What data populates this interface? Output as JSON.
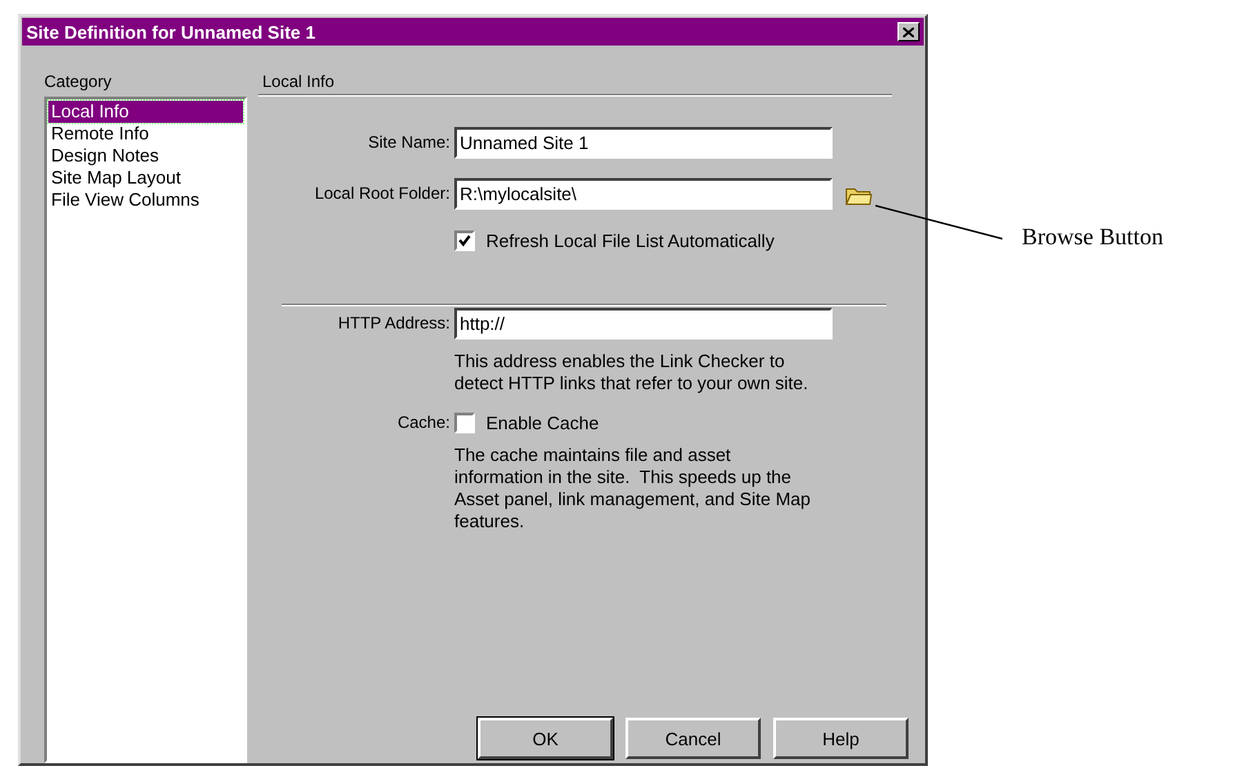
{
  "window": {
    "title": "Site Definition for Unnamed Site 1"
  },
  "category": {
    "label": "Category",
    "items": [
      {
        "label": "Local Info",
        "selected": true
      },
      {
        "label": "Remote Info",
        "selected": false
      },
      {
        "label": "Design Notes",
        "selected": false
      },
      {
        "label": "Site Map Layout",
        "selected": false
      },
      {
        "label": "File View Columns",
        "selected": false
      }
    ]
  },
  "panel": {
    "heading": "Local Info",
    "sections": [
      {
        "fields": [
          {
            "kind": "text",
            "label": "Site Name:",
            "value": "Unnamed Site 1"
          },
          {
            "kind": "folder",
            "label": "Local Root Folder:",
            "value": "R:\\mylocalsite\\"
          },
          {
            "kind": "checkbox",
            "text": "Refresh Local File List Automatically",
            "checked": true
          }
        ]
      },
      {
        "fields": [
          {
            "kind": "text",
            "label": "HTTP Address:",
            "value": "http://"
          },
          {
            "kind": "note",
            "text": "This address enables the Link Checker to detect HTTP links that refer to your own site."
          },
          {
            "kind": "checkbox",
            "label": "Cache:",
            "text": "Enable Cache",
            "checked": false
          },
          {
            "kind": "note",
            "text": "The cache maintains file and asset information in the site.  This speeds up the Asset panel, link management, and Site Map features."
          }
        ]
      }
    ]
  },
  "buttons": [
    {
      "label": "OK",
      "default": true
    },
    {
      "label": "Cancel",
      "default": false
    },
    {
      "label": "Help",
      "default": false
    }
  ],
  "annotation": {
    "label": "Browse Button"
  }
}
